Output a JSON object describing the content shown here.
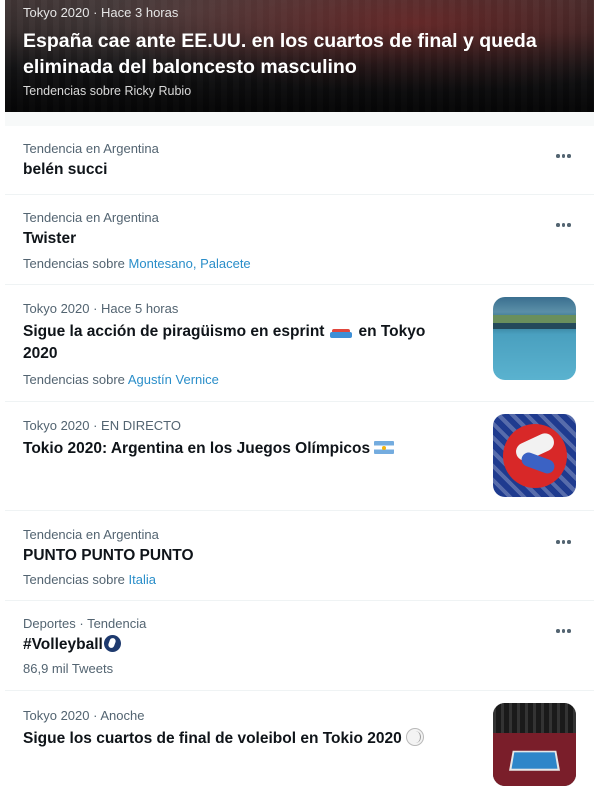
{
  "hero": {
    "meta": "Tokyo 2020 · Hace 3 horas",
    "title": "España cae ante EE.UU. en los cuartos de final y queda eliminada del baloncesto masculino",
    "tags_prefix": "Tendencias sobre",
    "tags_value": "Ricky Rubio"
  },
  "trends": [
    {
      "meta": "Tendencia en Argentina",
      "title": "belén succi"
    },
    {
      "meta": "Tendencia en Argentina",
      "title": "Twister",
      "sub_prefix": "Tendencias sobre",
      "sub_value": "Montesano, Palacete"
    },
    {
      "meta": "Tokyo 2020 · Hace 5 horas",
      "title_a": "Sigue la acción de piragüismo en esprint",
      "title_b": "en Tokyo",
      "title_c": "2020",
      "sub_prefix": "Tendencias sobre",
      "sub_value": "Agustín Vernice",
      "thumb_icon": "canoe-sprint-photo"
    },
    {
      "meta": "Tokyo 2020 · EN DIRECTO",
      "title": "Tokio 2020: Argentina en los Juegos Olímpicos",
      "thumb_icon": "judo-photo"
    },
    {
      "meta": "Tendencia en Argentina",
      "title": "PUNTO PUNTO PUNTO",
      "sub_prefix": "Tendencias sobre",
      "sub_value": "Italia"
    },
    {
      "meta": "Deportes · Tendencia",
      "title": "#Volleyball",
      "sub": "86,9 mil Tweets"
    },
    {
      "meta": "Tokyo 2020 · Anoche",
      "title": "Sigue los cuartos de final de voleibol en Tokio 2020",
      "thumb_icon": "volleyball-arena-photo"
    }
  ],
  "colors": {
    "link": "#2a8ec9",
    "secondary_text": "#536471",
    "divider": "#eff3f4"
  }
}
